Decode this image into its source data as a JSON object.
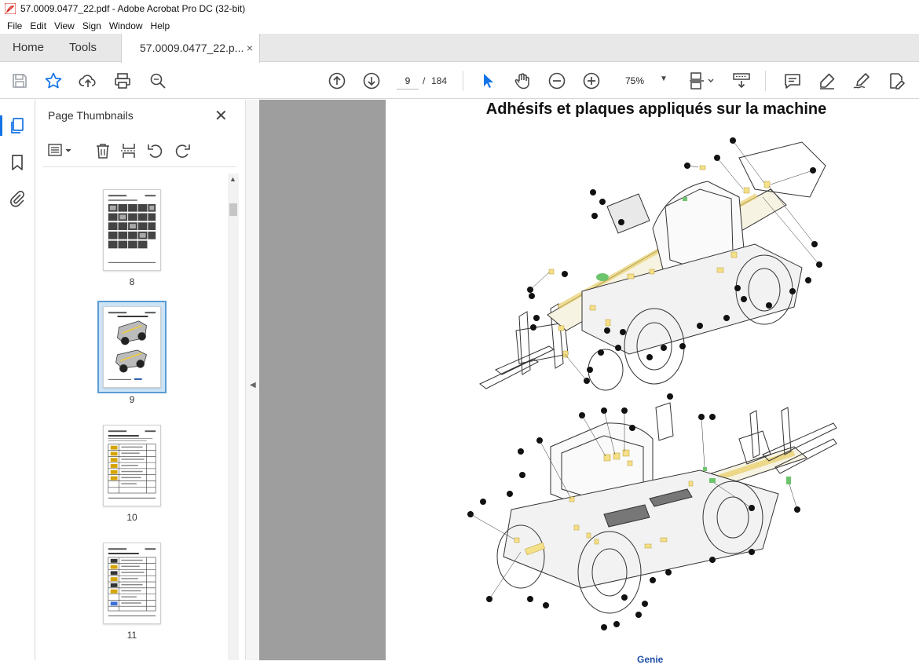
{
  "window": {
    "title": "57.0009.0477_22.pdf - Adobe Acrobat Pro DC (32-bit)"
  },
  "menu": [
    "File",
    "Edit",
    "View",
    "Sign",
    "Window",
    "Help"
  ],
  "tabs": {
    "home": "Home",
    "tools": "Tools",
    "document": "57.0009.0477_22.p...",
    "close": "×"
  },
  "toolbar": {
    "current_page": "9",
    "separator": "/",
    "total_pages": "184",
    "zoom": "75%",
    "icons": [
      "save-icon",
      "star-icon",
      "upload-icon",
      "print-icon",
      "find-icon",
      "prev-page-icon",
      "next-page-icon",
      "select-arrow-icon",
      "hand-icon",
      "zoom-out-icon",
      "zoom-in-icon",
      "page-fit-icon",
      "scroll-mode-icon",
      "comment-icon",
      "highlight-icon",
      "sign-icon",
      "edit-pdf-icon"
    ]
  },
  "panel": {
    "title": "Page Thumbnails",
    "close": "✕",
    "thumbnails": [
      {
        "label": "8",
        "selected": false
      },
      {
        "label": "9",
        "selected": true
      },
      {
        "label": "10",
        "selected": false
      },
      {
        "label": "11",
        "selected": false
      }
    ]
  },
  "document": {
    "heading": "Adhésifs et plaques appliqués sur la machine",
    "footer_partial": "Genie"
  },
  "colors": {
    "accent": "#1473e6",
    "decal_yellow": "#f5e08a",
    "decal_green": "#6cc46c",
    "doc_bg": "#9e9e9e"
  }
}
